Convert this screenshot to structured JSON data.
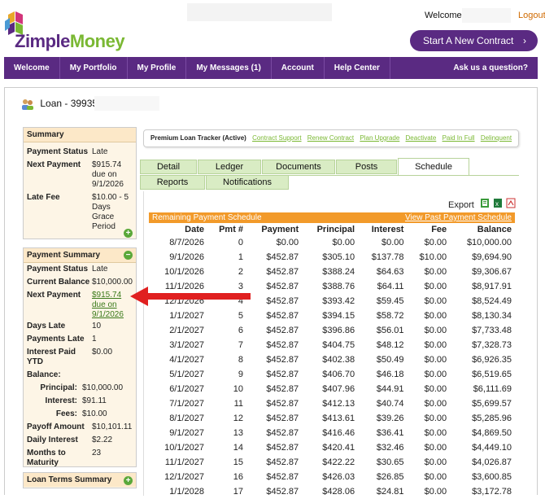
{
  "header": {
    "logo_text_a": "Zimple",
    "logo_text_b": "Money",
    "welcome": "Welcome,",
    "logout": "Logout",
    "start_contract": "Start A New Contract"
  },
  "nav": [
    "Welcome",
    "My Portfolio",
    "My Profile",
    "My Messages (1)",
    "Account",
    "Help Center"
  ],
  "nav_ask": "Ask us a question?",
  "loan_title": "Loan - 39935",
  "summary": {
    "title": "Summary",
    "rows": [
      {
        "k": "Payment Status",
        "v": "Late"
      },
      {
        "k": "Next Payment",
        "v": "$915.74 due on 9/1/2026"
      },
      {
        "k": "Late Fee",
        "v": "$10.00 - 5 Days Grace Period"
      }
    ]
  },
  "payment_summary": {
    "title": "Payment Summary",
    "payment_status_k": "Payment Status",
    "payment_status_v": "Late",
    "current_balance_k": "Current Balance",
    "current_balance_v": "$10,000.00",
    "next_payment_k": "Next Payment",
    "next_payment_v": "$915.74 due on 9/1/2026",
    "days_late_k": "Days Late",
    "days_late_v": "10",
    "payments_late_k": "Payments Late",
    "payments_late_v": "1",
    "interest_ytd_k": "Interest Paid YTD",
    "interest_ytd_v": "$0.00",
    "balance_k": "Balance:",
    "principal_k": "Principal:",
    "principal_v": "$10,000.00",
    "interest_k": "Interest:",
    "interest_v": "$91.11",
    "fees_k": "Fees:",
    "fees_v": "$10.00",
    "payoff_k": "Payoff Amount",
    "payoff_v": "$10,101.11",
    "daily_k": "Daily Interest",
    "daily_v": "$2.22",
    "months_k": "Months to Maturity",
    "months_v": "23"
  },
  "loan_terms_title": "Loan Terms Summary",
  "tracker": {
    "title": "Premium Loan Tracker (Active)",
    "links": [
      "Contract Support",
      "Renew Contract",
      "Plan Upgrade",
      "Deactivate",
      "Paid In Full",
      "Delinquent"
    ]
  },
  "tabs": [
    "Detail",
    "Ledger",
    "Documents",
    "Posts",
    "Schedule",
    "Reports",
    "Notifications"
  ],
  "export_label": "Export",
  "schedule": {
    "title": "Remaining Payment Schedule",
    "past_link": "View Past Payment Schedule",
    "headers": [
      "Date",
      "Pmt #",
      "Payment",
      "Principal",
      "Interest",
      "Fee",
      "Balance"
    ],
    "rows": [
      [
        "8/7/2026",
        "0",
        "$0.00",
        "$0.00",
        "$0.00",
        "$0.00",
        "$10,000.00"
      ],
      [
        "9/1/2026",
        "1",
        "$452.87",
        "$305.10",
        "$137.78",
        "$10.00",
        "$9,694.90"
      ],
      [
        "10/1/2026",
        "2",
        "$452.87",
        "$388.24",
        "$64.63",
        "$0.00",
        "$9,306.67"
      ],
      [
        "11/1/2026",
        "3",
        "$452.87",
        "$388.76",
        "$64.11",
        "$0.00",
        "$8,917.91"
      ],
      [
        "12/1/2026",
        "4",
        "$452.87",
        "$393.42",
        "$59.45",
        "$0.00",
        "$8,524.49"
      ],
      [
        "1/1/2027",
        "5",
        "$452.87",
        "$394.15",
        "$58.72",
        "$0.00",
        "$8,130.34"
      ],
      [
        "2/1/2027",
        "6",
        "$452.87",
        "$396.86",
        "$56.01",
        "$0.00",
        "$7,733.48"
      ],
      [
        "3/1/2027",
        "7",
        "$452.87",
        "$404.75",
        "$48.12",
        "$0.00",
        "$7,328.73"
      ],
      [
        "4/1/2027",
        "8",
        "$452.87",
        "$402.38",
        "$50.49",
        "$0.00",
        "$6,926.35"
      ],
      [
        "5/1/2027",
        "9",
        "$452.87",
        "$406.70",
        "$46.18",
        "$0.00",
        "$6,519.65"
      ],
      [
        "6/1/2027",
        "10",
        "$452.87",
        "$407.96",
        "$44.91",
        "$0.00",
        "$6,111.69"
      ],
      [
        "7/1/2027",
        "11",
        "$452.87",
        "$412.13",
        "$40.74",
        "$0.00",
        "$5,699.57"
      ],
      [
        "8/1/2027",
        "12",
        "$452.87",
        "$413.61",
        "$39.26",
        "$0.00",
        "$5,285.96"
      ],
      [
        "9/1/2027",
        "13",
        "$452.87",
        "$416.46",
        "$36.41",
        "$0.00",
        "$4,869.50"
      ],
      [
        "10/1/2027",
        "14",
        "$452.87",
        "$420.41",
        "$32.46",
        "$0.00",
        "$4,449.10"
      ],
      [
        "11/1/2027",
        "15",
        "$452.87",
        "$422.22",
        "$30.65",
        "$0.00",
        "$4,026.87"
      ],
      [
        "12/1/2027",
        "16",
        "$452.87",
        "$426.03",
        "$26.85",
        "$0.00",
        "$3,600.85"
      ],
      [
        "1/1/2028",
        "17",
        "$452.87",
        "$428.06",
        "$24.81",
        "$0.00",
        "$3,172.78"
      ]
    ]
  }
}
